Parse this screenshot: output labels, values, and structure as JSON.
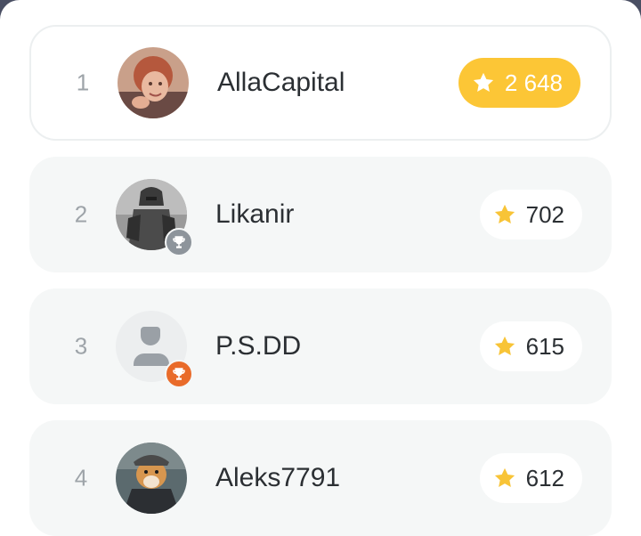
{
  "colors": {
    "gold": "#fcc636",
    "star": "#f8c437",
    "silver_trophy": "#8d949b",
    "bronze_trophy": "#e96b2a",
    "row_bg": "#f5f7f7"
  },
  "leaderboard": [
    {
      "rank": "1",
      "name": "AllaCapital",
      "score": "2 648",
      "avatar": "photo-woman",
      "trophy": "none",
      "highlight": true
    },
    {
      "rank": "2",
      "name": "Likanir",
      "score": "702",
      "avatar": "photo-knight",
      "trophy": "silver-trophy-icon",
      "highlight": false
    },
    {
      "rank": "3",
      "name": "P.S.DD",
      "score": "615",
      "avatar": "default-user-icon",
      "trophy": "bronze-trophy-icon",
      "highlight": false
    },
    {
      "rank": "4",
      "name": "Aleks7791",
      "score": "612",
      "avatar": "photo-dog",
      "trophy": "none",
      "highlight": false
    }
  ]
}
